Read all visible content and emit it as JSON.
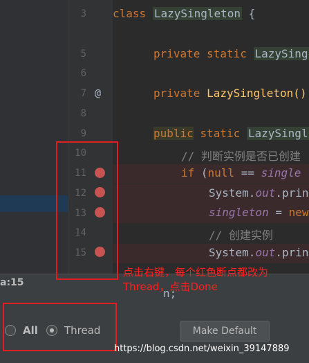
{
  "editor": {
    "line_numbers": [
      "3",
      "5",
      "6",
      "7",
      "8",
      "9",
      "10",
      "11",
      "12",
      "13",
      "14",
      "15"
    ],
    "lines": {
      "l3": {
        "kw": "class",
        "cls": "LazySingleton",
        "rest": " {"
      },
      "l5": {
        "kw": "private static",
        "cls": "LazySing"
      },
      "l7": {
        "kw": "private",
        "mth": "LazySingleton()"
      },
      "l9": {
        "kw": "public",
        "kw2": "static",
        "cls": "LazySingl"
      },
      "l10": {
        "cmt": "// 判断实例是否已创建"
      },
      "l11": {
        "kw": "if",
        "a": " (",
        "kw2": "null",
        "b": " == ",
        "fld": "single"
      },
      "l12": {
        "a": "System.",
        "fld": "out",
        "b": ".prin"
      },
      "l13": {
        "fld": "singleton",
        "a": " = ",
        "kw": "new"
      },
      "l14": {
        "cmt": "// 创建实例"
      },
      "l15": {
        "a": "System.",
        "fld": "out",
        "b": ".prin"
      },
      "l16": {
        "a": "n;"
      }
    },
    "at_icon": "@"
  },
  "dialog": {
    "location_label": "a:15",
    "suspend_options": [
      {
        "label": "All",
        "selected": false
      },
      {
        "label": "Thread",
        "selected": true
      }
    ],
    "make_default_label": "Make Default"
  },
  "annotation": {
    "note": "点击右键，每个红色断点都改为Thread，点击Done",
    "color": "#e02020"
  },
  "watermark": "https://blog.csdn.net/weixin_39147889"
}
